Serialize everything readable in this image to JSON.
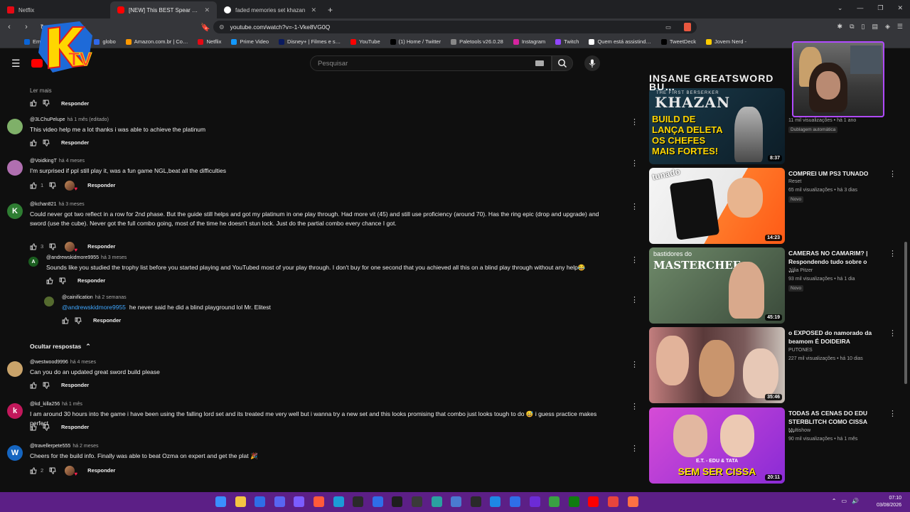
{
  "tabs": [
    {
      "label": "Netflix",
      "active": false,
      "color": "#e50914"
    },
    {
      "label": "[NEW] This BEST Spear Build DE…",
      "active": true,
      "color": "#ff0000"
    },
    {
      "label": "faded memories set khazan - Pesqui…",
      "active": false,
      "color": "#4285f4"
    }
  ],
  "address": {
    "url": "youtube.com/watch?v=-1-Vke8VG0Q"
  },
  "bookmarks": [
    {
      "label": "Email - Thiago Urur…",
      "color": "#0a64d6"
    },
    {
      "label": "globo",
      "color": "#2f68e8"
    },
    {
      "label": "Amazon.com.br | Co…",
      "color": "#ff9900"
    },
    {
      "label": "Netflix",
      "color": "#e50914"
    },
    {
      "label": "Prime Video",
      "color": "#1399ff"
    },
    {
      "label": "Disney+ | Filmes e s…",
      "color": "#0a1a5e"
    },
    {
      "label": "YouTube",
      "color": "#ff0000"
    },
    {
      "label": "(1) Home / Twitter",
      "color": "#000000"
    },
    {
      "label": "Paletools v26.0.28",
      "color": "#888888"
    },
    {
      "label": "Instagram",
      "color": "#d6249f"
    },
    {
      "label": "Twitch",
      "color": "#9146ff"
    },
    {
      "label": "Quem está assistind…",
      "color": "#ffffff"
    },
    {
      "label": "TweetDeck",
      "color": "#000000"
    },
    {
      "label": "Jovem Nerd -",
      "color": "#ffcc00"
    }
  ],
  "logo": {
    "letters": "KTV"
  },
  "search": {
    "placeholder": "Pesquisar"
  },
  "comments": [
    {
      "type": "more",
      "text": "Ler mais",
      "reply": "Responder"
    },
    {
      "author": "@3LChuPelupe",
      "time": "há 1 mês (editado)",
      "text": "This video help me a lot thanks i was able to achieve the platinum",
      "likes": "",
      "hearted": false,
      "reply": "Responder",
      "avatar_letter": "",
      "avatar_color": "#7fb069"
    },
    {
      "author": "@VoidkingT",
      "time": "há 4 meses",
      "text": "I'm surprised if ppl still play it, was a fun game NGL,beat all the difficulties",
      "likes": "1",
      "hearted": true,
      "reply": "Responder",
      "avatar_letter": "",
      "avatar_color": "#b06fb0"
    },
    {
      "author": "@kchan821",
      "time": "há 3 meses",
      "text": "Could never got two reflect in a row for 2nd phase. But the guide still helps and got my platinum in one play through. Had more vit (45) and still use proficiency (around 70). Has the ring epic (drop and upgrade) and sword (use the cube). Never got the full combo going, most of the time he doesn't stun lock. Just do the partial combo every chance I got.",
      "likes": "3",
      "hearted": true,
      "reply": "Responder",
      "avatar_letter": "K",
      "avatar_color": "#2e7d32"
    },
    {
      "author": "@andrewskidmore9955",
      "time": "há 3 meses",
      "text": "Sounds like you studied the trophy list before you started playing and YouTubed most of your play through. I don't buy for one second that you achieved all this on a blind play through without any help😂",
      "likes": "",
      "hearted": false,
      "reply": "Responder",
      "avatar_letter": "A",
      "avatar_color": "#1b5e20"
    },
    {
      "author": "@cainification",
      "time": "há 2 semanas",
      "mention": "@andrewskidmore9955",
      "text": "he never said he did a blind playground lol Mr. Elitest",
      "likes": "",
      "hearted": false,
      "reply": "Responder",
      "avatar_letter": "",
      "avatar_color": "#556b2f"
    },
    {
      "type": "hide",
      "text": "Ocultar respostas"
    },
    {
      "author": "@westwood9996",
      "time": "há 4 meses",
      "text": "Can you do an updated great sword build please",
      "likes": "",
      "hearted": false,
      "reply": "Responder",
      "avatar_letter": "",
      "avatar_color": "#c9a36a"
    },
    {
      "author": "@kd_killa256",
      "time": "há 1 mês",
      "text": "I am around 30 hours into the game i have been using the falling lord set and its treated me very well but i wanna try a new set and this looks promising that combo just looks tough to do 😅 i guess practice makes perfect",
      "likes": "",
      "hearted": false,
      "reply": "Responder",
      "avatar_letter": "k",
      "avatar_color": "#c2185b"
    },
    {
      "author": "@travellerpete555",
      "time": "há 2 meses",
      "text": "Cheers for the build info. Finally was able to beat Ozma on expert and get the plat 🎉",
      "likes": "2",
      "hearted": true,
      "reply": "Responder",
      "avatar_letter": "W",
      "avatar_color": "#1565c0"
    }
  ],
  "videos": [
    {
      "title": "INSANE GREATSWORD BU…",
      "thumb_text": "KHAZAN",
      "thumb_sub": "THE FIRST BERSERKER",
      "thumb_overlay": "BUILD DE LANÇA DELETA OS CHEFES MAIS FORTES!",
      "duration": "8:37",
      "channel": "",
      "meta": "11 mil visualizações • há 1 ano",
      "badge": "Dublagem automática"
    },
    {
      "title": "COMPREI UM PS3 TUNADO",
      "thumb_text": "tunado",
      "duration": "14:23",
      "channel": "Reset",
      "meta": "65 mil visualizações • há 3 dias",
      "badge": "Novo"
    },
    {
      "title": "CAMERAS NO CAMARIM? | Respondendo tudo sobre o …",
      "thumb_text": "MASTERCHEF",
      "thumb_sub": "bastidores do",
      "duration": "45:19",
      "channel": "Júlia Pitzer",
      "meta": "93 mil visualizações • há 1 dia",
      "badge": "Novo"
    },
    {
      "title": "o EXPOSED do namorado da beamom É DOIDEIRA",
      "thumb_text": "",
      "duration": "35:46",
      "channel": "PUTONES",
      "meta": "227 mil visualizações • há 10 dias",
      "badge": ""
    },
    {
      "title": "TODAS AS CENAS DO EDU STERBLITCH COMO CISSA …",
      "thumb_text": "SEM SER CISSA",
      "thumb_sub": "E.T. - EDU & TATA",
      "duration": "20:11",
      "channel": "Multishow",
      "meta": "90 mil visualizações • há 1 mês",
      "badge": ""
    }
  ],
  "clock": {
    "time": "07:10",
    "date": "03/08/2026"
  }
}
